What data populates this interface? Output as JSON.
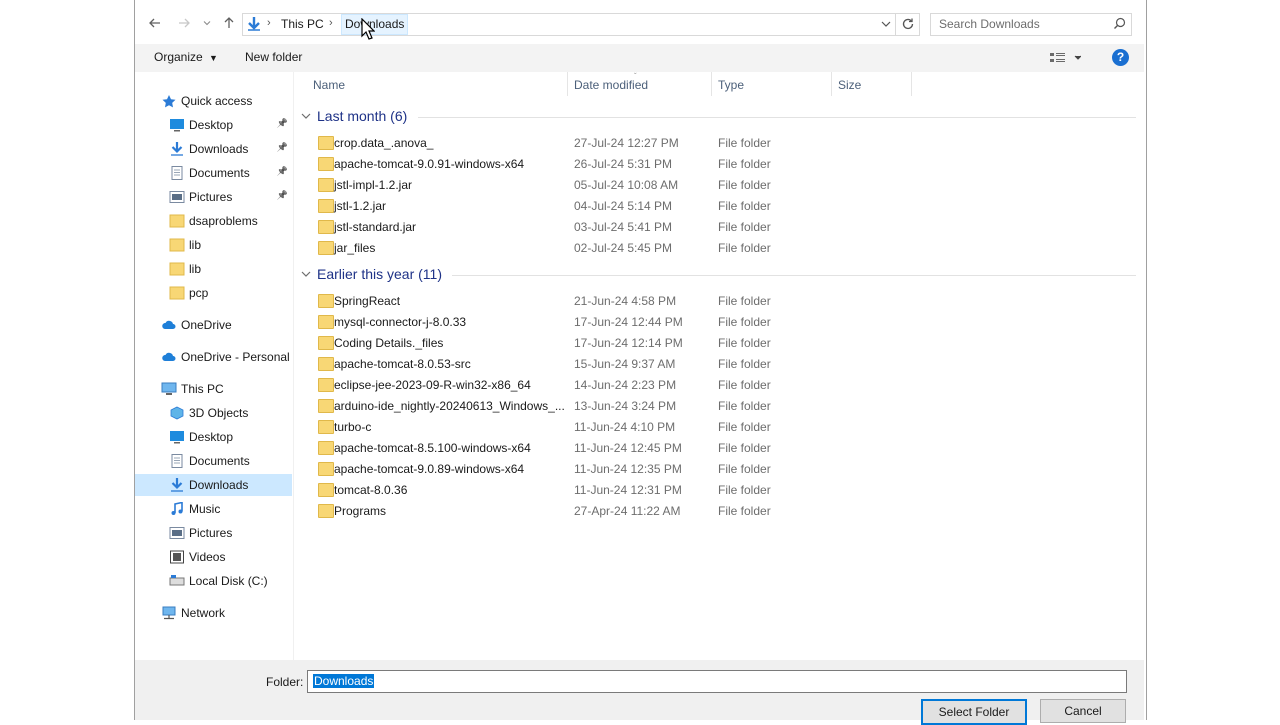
{
  "address": {
    "crumbs": [
      "This PC",
      "Downloads"
    ]
  },
  "search": {
    "placeholder": "Search Downloads"
  },
  "toolbar": {
    "organize_label": "Organize",
    "new_folder_label": "New folder"
  },
  "navpane": {
    "items": [
      {
        "label": "Quick access",
        "icon": "star-icon",
        "pinned": false
      },
      {
        "label": "Desktop",
        "icon": "desktop-icon",
        "pinned": true
      },
      {
        "label": "Downloads",
        "icon": "download-icon",
        "pinned": true
      },
      {
        "label": "Documents",
        "icon": "documents-icon",
        "pinned": true
      },
      {
        "label": "Pictures",
        "icon": "pictures-icon",
        "pinned": true
      },
      {
        "label": "dsaproblems",
        "icon": "folder-icon",
        "pinned": false
      },
      {
        "label": "lib",
        "icon": "folder-icon",
        "pinned": false
      },
      {
        "label": "lib",
        "icon": "folder-icon",
        "pinned": false
      },
      {
        "label": "pcp",
        "icon": "folder-icon",
        "pinned": false
      },
      {
        "label": "OneDrive",
        "icon": "cloud-icon",
        "pinned": false
      },
      {
        "label": "OneDrive - Personal",
        "icon": "cloud-icon",
        "pinned": false
      },
      {
        "label": "This PC",
        "icon": "computer-icon",
        "pinned": false
      },
      {
        "label": "3D Objects",
        "icon": "cube-icon",
        "pinned": false
      },
      {
        "label": "Desktop",
        "icon": "desktop-icon",
        "pinned": false
      },
      {
        "label": "Documents",
        "icon": "documents-icon",
        "pinned": false
      },
      {
        "label": "Downloads",
        "icon": "download-icon",
        "pinned": false,
        "selected": true
      },
      {
        "label": "Music",
        "icon": "music-icon",
        "pinned": false
      },
      {
        "label": "Pictures",
        "icon": "pictures-icon",
        "pinned": false
      },
      {
        "label": "Videos",
        "icon": "video-icon",
        "pinned": false
      },
      {
        "label": "Local Disk (C:)",
        "icon": "disk-icon",
        "pinned": false
      },
      {
        "label": "Network",
        "icon": "network-icon",
        "pinned": false
      }
    ]
  },
  "columns": {
    "name": "Name",
    "date": "Date modified",
    "type": "Type",
    "size": "Size"
  },
  "groups": [
    {
      "title": "Last month (6)",
      "rows": [
        {
          "name": "crop.data_.anova_",
          "date": "27-Jul-24 12:27 PM",
          "type": "File folder"
        },
        {
          "name": "apache-tomcat-9.0.91-windows-x64",
          "date": "26-Jul-24 5:31 PM",
          "type": "File folder"
        },
        {
          "name": "jstl-impl-1.2.jar",
          "date": "05-Jul-24 10:08 AM",
          "type": "File folder"
        },
        {
          "name": "jstl-1.2.jar",
          "date": "04-Jul-24 5:14 PM",
          "type": "File folder"
        },
        {
          "name": "jstl-standard.jar",
          "date": "03-Jul-24 5:41 PM",
          "type": "File folder"
        },
        {
          "name": "jar_files",
          "date": "02-Jul-24 5:45 PM",
          "type": "File folder"
        }
      ]
    },
    {
      "title": "Earlier this year (11)",
      "rows": [
        {
          "name": "SpringReact",
          "date": "21-Jun-24 4:58 PM",
          "type": "File folder"
        },
        {
          "name": "mysql-connector-j-8.0.33",
          "date": "17-Jun-24 12:44 PM",
          "type": "File folder"
        },
        {
          "name": "Coding Details._files",
          "date": "17-Jun-24 12:14 PM",
          "type": "File folder"
        },
        {
          "name": "apache-tomcat-8.0.53-src",
          "date": "15-Jun-24 9:37 AM",
          "type": "File folder"
        },
        {
          "name": "eclipse-jee-2023-09-R-win32-x86_64",
          "date": "14-Jun-24 2:23 PM",
          "type": "File folder"
        },
        {
          "name": "arduino-ide_nightly-20240613_Windows_...",
          "date": "13-Jun-24 3:24 PM",
          "type": "File folder"
        },
        {
          "name": "turbo-c",
          "date": "11-Jun-24 4:10 PM",
          "type": "File folder"
        },
        {
          "name": "apache-tomcat-8.5.100-windows-x64",
          "date": "11-Jun-24 12:45 PM",
          "type": "File folder"
        },
        {
          "name": "apache-tomcat-9.0.89-windows-x64",
          "date": "11-Jun-24 12:35 PM",
          "type": "File folder"
        },
        {
          "name": "tomcat-8.0.36",
          "date": "11-Jun-24 12:31 PM",
          "type": "File folder"
        },
        {
          "name": "Programs",
          "date": "27-Apr-24 11:22 AM",
          "type": "File folder"
        }
      ]
    }
  ],
  "footer": {
    "folder_label": "Folder:",
    "folder_value": "Downloads",
    "select_label": "Select Folder",
    "cancel_label": "Cancel"
  },
  "colors": {
    "selection": "#cce8ff",
    "accent": "#0078d7",
    "folder": "#f8d775",
    "group_title": "#1e3287"
  }
}
